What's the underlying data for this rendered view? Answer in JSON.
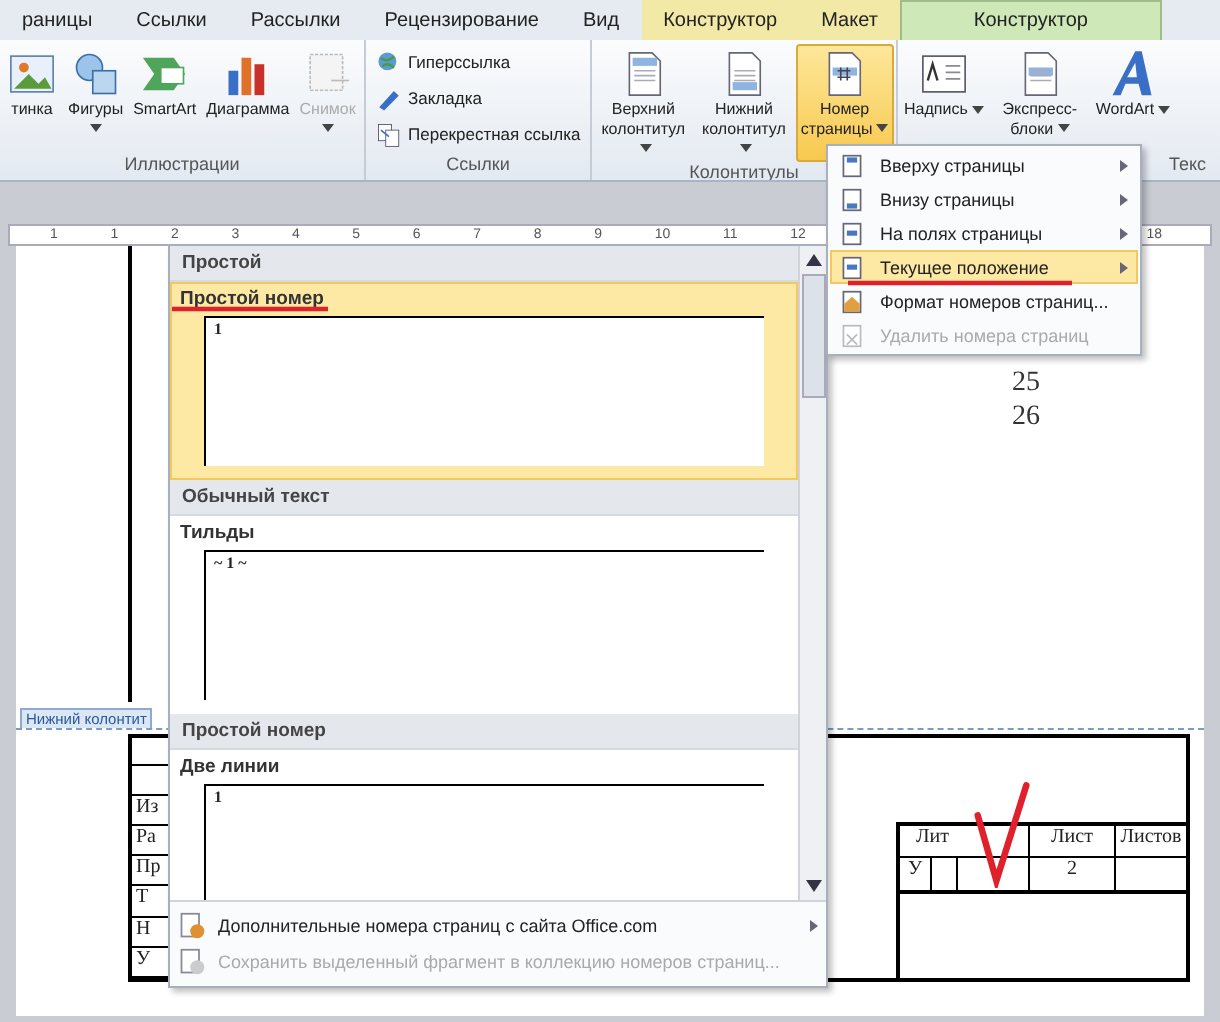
{
  "tabs": [
    {
      "label": "раницы",
      "kind": "plain",
      "selected": false
    },
    {
      "label": "Ссылки",
      "kind": "plain",
      "selected": false
    },
    {
      "label": "Рассылки",
      "kind": "plain",
      "selected": false
    },
    {
      "label": "Рецензирование",
      "kind": "plain",
      "selected": false
    },
    {
      "label": "Вид",
      "kind": "plain",
      "selected": false
    },
    {
      "label": "Конструктор",
      "kind": "context",
      "color": "#f3e9a6",
      "selected": false
    },
    {
      "label": "Макет",
      "kind": "context",
      "color": "#f3e9a6",
      "selected": false
    },
    {
      "label": "Конструктор",
      "kind": "context",
      "color": "#cfe8b8",
      "selected": true
    }
  ],
  "ribbon_groups": [
    {
      "label": "Иллюстрации",
      "kind": "large",
      "items": [
        {
          "label": "тинка",
          "caret": false,
          "disabled": false,
          "selected": false
        },
        {
          "label": "Фигуры",
          "caret": true,
          "disabled": false,
          "selected": false
        },
        {
          "label": "SmartArt",
          "caret": false,
          "disabled": false,
          "selected": false
        },
        {
          "label": "Диаграмма",
          "caret": false,
          "disabled": false,
          "selected": false
        },
        {
          "label": "Снимок",
          "caret": true,
          "disabled": true,
          "selected": false
        }
      ]
    },
    {
      "label": "Ссылки",
      "kind": "small",
      "items": [
        {
          "label": "Гиперссылка",
          "disabled": false,
          "selected": false
        },
        {
          "label": "Закладка",
          "disabled": false,
          "selected": false
        },
        {
          "label": "Перекрестная ссылка",
          "disabled": false,
          "selected": false
        }
      ]
    },
    {
      "label": "Колонтитулы",
      "kind": "large",
      "items": [
        {
          "label": "Верхний колонтитул",
          "caret": true,
          "disabled": false,
          "selected": false
        },
        {
          "label": "Нижний колонтитул",
          "caret": true,
          "disabled": false,
          "selected": false
        },
        {
          "label": "Номер страницы",
          "caret": true,
          "disabled": false,
          "selected": true
        }
      ]
    },
    {
      "label": "Текс",
      "kind": "large",
      "items": [
        {
          "label": "Надпись",
          "caret": true,
          "disabled": false,
          "selected": false
        },
        {
          "label": "Экспресс-блоки",
          "caret": true,
          "disabled": false,
          "selected": false
        },
        {
          "label": "WordArt",
          "caret": true,
          "disabled": false,
          "selected": false
        }
      ]
    }
  ],
  "ruler": {
    "labels": [
      "1",
      "1",
      "2",
      "3",
      "4",
      "5",
      "6",
      "7",
      "8",
      "9",
      "10",
      "11",
      "12"
    ],
    "far_label": "18"
  },
  "page": {
    "numbers": [
      "25",
      "26"
    ],
    "footer_tab": "Нижний колонтит",
    "left_cells": [
      "Из",
      "Ра",
      "Пр",
      "Т",
      "Н",
      "У"
    ],
    "title_block": {
      "header": [
        "Лит",
        "Лист",
        "Листов"
      ],
      "letter": "У",
      "sheet": "2"
    }
  },
  "page_number_menu": {
    "items": [
      {
        "label": "Вверху страницы",
        "submenu": true,
        "selected": false,
        "disabled": false
      },
      {
        "label": "Внизу страницы",
        "submenu": true,
        "selected": false,
        "disabled": false
      },
      {
        "label": "На полях страницы",
        "submenu": true,
        "selected": false,
        "disabled": false
      },
      {
        "label": "Текущее положение",
        "submenu": true,
        "selected": true,
        "disabled": false
      },
      {
        "label": "Формат номеров страниц...",
        "submenu": false,
        "selected": false,
        "disabled": false
      },
      {
        "label": "Удалить номера страниц",
        "submenu": false,
        "selected": false,
        "disabled": true
      }
    ]
  },
  "gallery": {
    "sections": [
      {
        "header": "Простой",
        "items": [
          {
            "title": "Простой номер",
            "preview": "1",
            "selected": true
          }
        ]
      },
      {
        "header": "Обычный текст",
        "items": [
          {
            "title": "Тильды",
            "preview": "~ 1 ~",
            "selected": false
          }
        ]
      },
      {
        "header": "Простой номер",
        "items": [
          {
            "title": "Две линии",
            "preview": "1",
            "selected": false
          }
        ]
      }
    ],
    "footer": [
      {
        "label": "Дополнительные номера страниц с сайта Office.com",
        "submenu": true,
        "disabled": false
      },
      {
        "label": "Сохранить выделенный фрагмент в коллекцию номеров страниц...",
        "submenu": false,
        "disabled": true
      }
    ]
  }
}
